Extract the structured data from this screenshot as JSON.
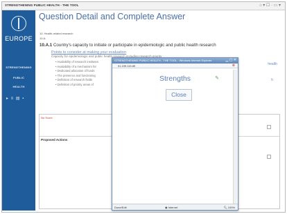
{
  "browser": {
    "app_tab": "STRENGTHENING PUBLIC HEALTH - THE TOOL",
    "toolbar_icons": "⌂ ▾ ☐ · ▭ ▾"
  },
  "sidebar": {
    "logo_label": "EUROPE",
    "items": [
      "STRENGTHENING",
      "PUBLIC",
      "HEALTH"
    ],
    "icons": "▸ ≡ ▤ ▪"
  },
  "page": {
    "title": "Question Detail and Complete Answer",
    "breadcrumb_1": "10.  Health-related research",
    "breadcrumb_2": "10.A:",
    "question_code": "10.A.1",
    "question_text": "Country's capacity to initiate or participate in epidemiologic and public health research",
    "hint_heading": "Points to consider at making your evaluation",
    "hint_text": "Capacity for epidemiologic and public health research including research priority",
    "bullets": [
      "Availability of research institutes",
      "Availability of a mechanism for",
      "Dedicated allocation of funds",
      "The presence and functioning",
      "Definition of research fields",
      "Definition of priority areas of"
    ],
    "right_frag_1": "health",
    "right_frag_2": "h",
    "score_label": "No Score",
    "proposed_label": "Proposed Actions"
  },
  "popup": {
    "title": "STRENGTHENING PUBLIC HEALTH - THE TOOL - Windows Internet Explorer",
    "window_buttons": "▁ ▢ ✕",
    "address": "91.199.115.89",
    "heading": "Strengths",
    "close_label": "Close",
    "status_done": "Done/Edit",
    "status_zone": "Internet",
    "status_zoom": "100%"
  }
}
